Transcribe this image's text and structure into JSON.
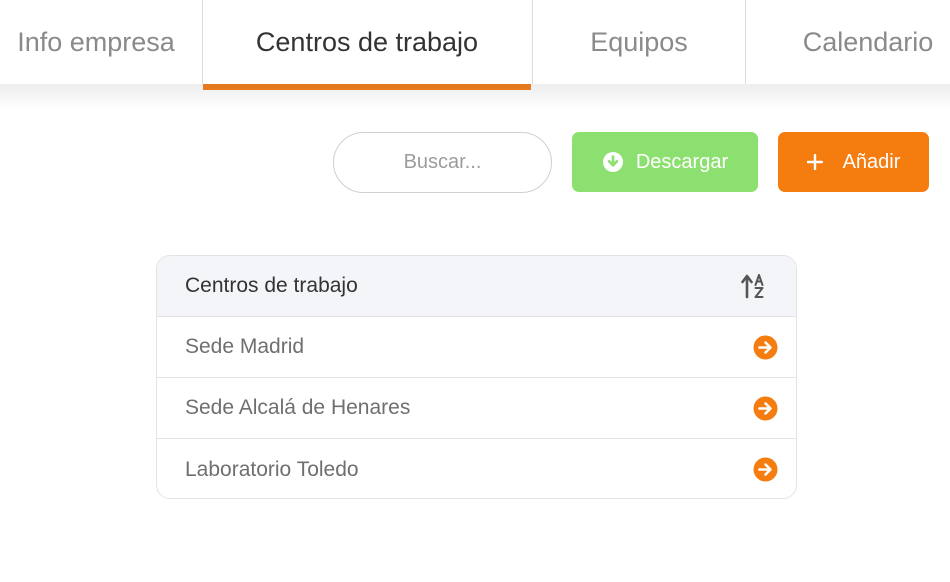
{
  "tabs": [
    {
      "label": "Info empresa",
      "active": false
    },
    {
      "label": "Centros de trabajo",
      "active": true
    },
    {
      "label": "Equipos",
      "active": false
    },
    {
      "label": "Calendario",
      "active": false
    }
  ],
  "toolbar": {
    "search_placeholder": "Buscar...",
    "download_label": "Descargar",
    "add_label": "Añadir"
  },
  "table": {
    "header": "Centros de trabajo",
    "sort_icon": "sort-alpha-asc-icon",
    "rows": [
      {
        "label": "Sede Madrid"
      },
      {
        "label": "Sede Alcalá de Henares"
      },
      {
        "label": "Laboratorio Toledo"
      }
    ]
  },
  "colors": {
    "accent_orange": "#f57c0f",
    "download_green": "#8ce070",
    "tab_underline": "#f58220"
  }
}
